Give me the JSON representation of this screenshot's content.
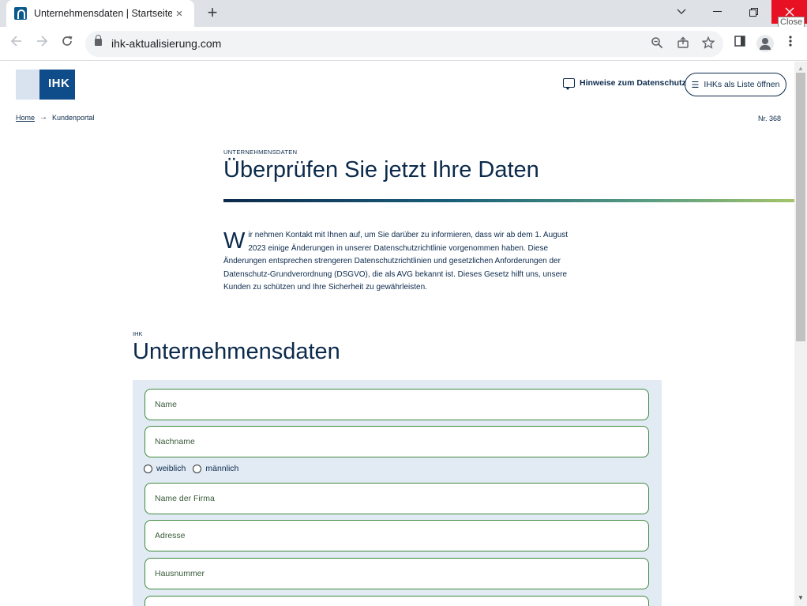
{
  "browser": {
    "tab_title": "Unternehmensdaten | Startseite",
    "tab_close": "×",
    "new_tab": "+",
    "url": "ihk-aktualisierung.com",
    "close_tooltip": "Close",
    "icons": [
      "back-icon",
      "forward-icon",
      "reload-icon",
      "lock-icon",
      "zoom-icon",
      "share-icon",
      "bookmark-star-icon",
      "side-panel-icon",
      "profile-icon",
      "menu-icon"
    ]
  },
  "header": {
    "logo_text": "IHK",
    "privacy_link": "Hinweise zum Datenschutz",
    "list_button": "IHKs als Liste öffnen"
  },
  "breadcrumb": {
    "home": "Home",
    "current": "Kundenportal"
  },
  "nr": "Nr. 368",
  "hero": {
    "eyebrow": "UNTERNEHMENSDATEN",
    "title": "Überprüfen Sie jetzt Ihre Daten",
    "dropcap": "W",
    "intro": "ir nehmen Kontakt mit Ihnen auf, um Sie darüber zu informieren, dass wir ab dem 1. August 2023 einige Änderungen in unserer Datenschutzrichtlinie vorgenommen haben. Diese Änderungen entsprechen strengeren Datenschutzrichtlinien und gesetzlichen Anforderungen der Datenschutz-Grundverordnung (DSGVO), die als AVG bekannt ist. Dieses Gesetz hilft uns, unsere Kunden zu schützen und Ihre Sicherheit zu gewährleisten."
  },
  "form": {
    "eyebrow": "IHK",
    "title": "Unternehmensdaten",
    "fields": {
      "name": "Name",
      "nachname": "Nachname",
      "firma": "Name der Firma",
      "adresse": "Adresse",
      "hausnummer": "Hausnummer"
    },
    "radio_female": "weiblich",
    "radio_male": "männlich"
  }
}
